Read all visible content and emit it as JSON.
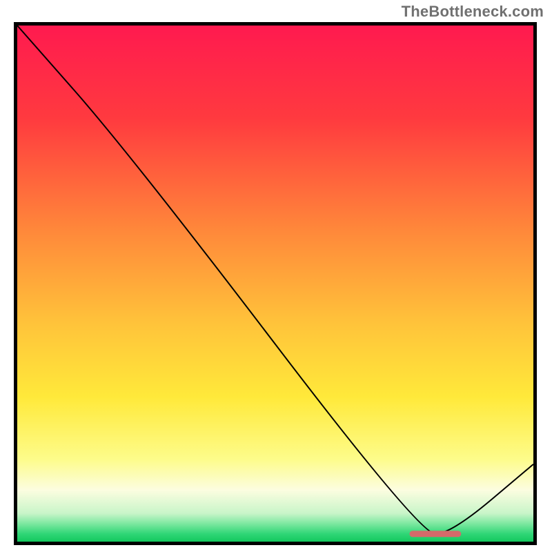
{
  "watermark": "TheBottleneck.com",
  "chart_data": {
    "type": "line",
    "title": "",
    "xlabel": "",
    "ylabel": "",
    "xlim": [
      0,
      100
    ],
    "ylim": [
      0,
      100
    ],
    "grid": false,
    "series": [
      {
        "name": "curve",
        "x": [
          0,
          22,
          78,
          84,
          100
        ],
        "y": [
          100,
          75,
          1.5,
          1.5,
          15
        ],
        "color": "#000000",
        "width": 2
      }
    ],
    "optimal_marker": {
      "x_start": 76,
      "x_end": 86,
      "y": 1.5,
      "color": "#d46a6a",
      "thickness": 1.2
    },
    "background_gradient": {
      "stops": [
        {
          "offset": 0.0,
          "color": "#ff1a4f"
        },
        {
          "offset": 0.18,
          "color": "#ff3a3f"
        },
        {
          "offset": 0.4,
          "color": "#ff893a"
        },
        {
          "offset": 0.58,
          "color": "#ffc43a"
        },
        {
          "offset": 0.72,
          "color": "#ffe93a"
        },
        {
          "offset": 0.84,
          "color": "#fdfc8a"
        },
        {
          "offset": 0.9,
          "color": "#fcfde0"
        },
        {
          "offset": 0.945,
          "color": "#c9f5c9"
        },
        {
          "offset": 0.965,
          "color": "#7de8a0"
        },
        {
          "offset": 0.985,
          "color": "#2fd676"
        },
        {
          "offset": 1.0,
          "color": "#14c85f"
        }
      ]
    }
  }
}
